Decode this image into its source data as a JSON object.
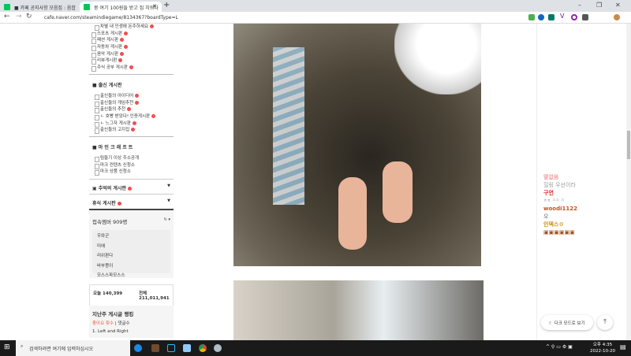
{
  "browser": {
    "tabs": [
      {
        "label": "■ 카페 공지사항 모음집 : 음합",
        "active": false
      },
      {
        "label": "뭉 여기 100원들 받고 집 치워다",
        "active": true
      }
    ],
    "url": "cafe.naver.com/steamindiegame/8134367?boardType=L"
  },
  "sidebar": {
    "items1": [
      "차별 내 인생에 돈주하세요",
      "스포츠 게시판",
      "패션 게시판",
      "자동차 게시판",
      "음악 게시판",
      "리뷰게시판",
      "주식 공부 게시판"
    ],
    "section2": "■ 출신 게시판",
    "items2": [
      "출신들의 아이디어",
      "출신들의 게임추천",
      "출신들의 추천",
      "ㄴ 호빵 받았다! 인증게시판",
      "ㄴ 느그자 게시판",
      "출신들의 고지집"
    ],
    "section3": "■ 마 인 크 래 프 트",
    "items3": [
      "팀들기 이상 주소공개",
      "마크 컨텐츠 신청소",
      "마크 상품 신청소"
    ],
    "fold1": "추억의 게시판",
    "fold2": "휴식 게시판",
    "members_title": "접속멤버 909명",
    "members": [
      "우와군",
      "미애",
      "러쉬판다",
      "바부몽이",
      "모스스파모스스"
    ],
    "today_label": "오늘",
    "today": "140,399",
    "total_label": "전체",
    "total": "211,011,941",
    "ranking_title": "지난주 게시글 랭킹",
    "ranking_tab1": "좋아요 횟수",
    "ranking_tab2": "댓글수",
    "ranking_first": "1. Left and Right"
  },
  "chat": [
    {
      "name": "멸없음",
      "color": "#f2a0a0"
    },
    {
      "text": "힐링 우선이라",
      "color": "#999"
    },
    {
      "name": "구언",
      "color": "#e0201c"
    },
    {
      "text": "ㅎㅎ ㅋㅋ ㅋ",
      "color": "#999"
    },
    {
      "name": "woodi1122",
      "color": "#c8501a"
    },
    {
      "text": "오",
      "color": "#666"
    },
    {
      "name": "인덱스ㅇ",
      "color": "#c98a00"
    }
  ],
  "dark_mode": "다크 모드로 보기",
  "taskbar": {
    "search_placeholder": "검색하려면 여기에 입력하십시오",
    "time": "오후 4:35",
    "date": "2022-10-20"
  }
}
